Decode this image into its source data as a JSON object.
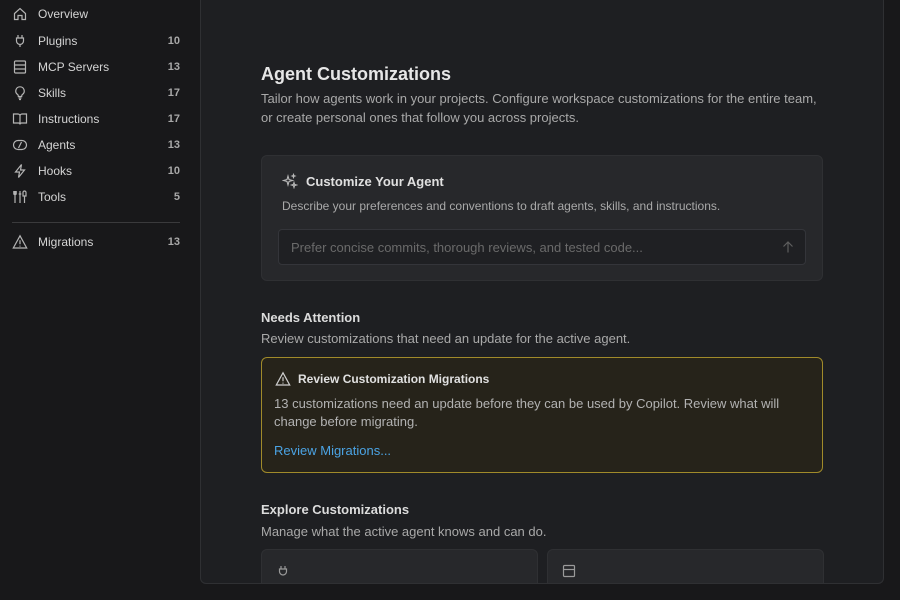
{
  "sidebar": {
    "items": [
      {
        "label": "Overview",
        "count": "",
        "icon": "home-icon"
      },
      {
        "label": "Plugins",
        "count": "10",
        "icon": "plug-icon"
      },
      {
        "label": "MCP Servers",
        "count": "13",
        "icon": "server-icon"
      },
      {
        "label": "Skills",
        "count": "17",
        "icon": "lightbulb-icon"
      },
      {
        "label": "Instructions",
        "count": "17",
        "icon": "book-icon"
      },
      {
        "label": "Agents",
        "count": "13",
        "icon": "agent-icon"
      },
      {
        "label": "Hooks",
        "count": "10",
        "icon": "lightning-icon"
      },
      {
        "label": "Tools",
        "count": "5",
        "icon": "tools-icon"
      }
    ],
    "migrations": {
      "label": "Migrations",
      "count": "13",
      "icon": "warning-icon"
    }
  },
  "main": {
    "title": "Agent Customizations",
    "description": "Tailor how agents work in your projects. Configure workspace customizations for the entire team, or create personal ones that follow you across projects.",
    "customize": {
      "title": "Customize Your Agent",
      "description": "Describe your preferences and conventions to draft agents, skills, and instructions.",
      "placeholder": "Prefer concise commits, thorough reviews, and tested code...",
      "value": ""
    },
    "needs_attention": {
      "heading": "Needs Attention",
      "description": "Review customizations that need an update for the active agent.",
      "warning": {
        "title": "Review Customization Migrations",
        "body": "13 customizations need an update before they can be used by Copilot. Review what will change before migrating.",
        "link": "Review Migrations..."
      }
    },
    "explore": {
      "heading": "Explore Customizations",
      "description": "Manage what the active agent knows and can do."
    }
  },
  "colors": {
    "background": "#18181a",
    "panel": "#1e1f22",
    "card": "#27282b",
    "warning_border": "#a08a2a",
    "warning_bg": "#26231a",
    "link": "#4ba3e3"
  }
}
